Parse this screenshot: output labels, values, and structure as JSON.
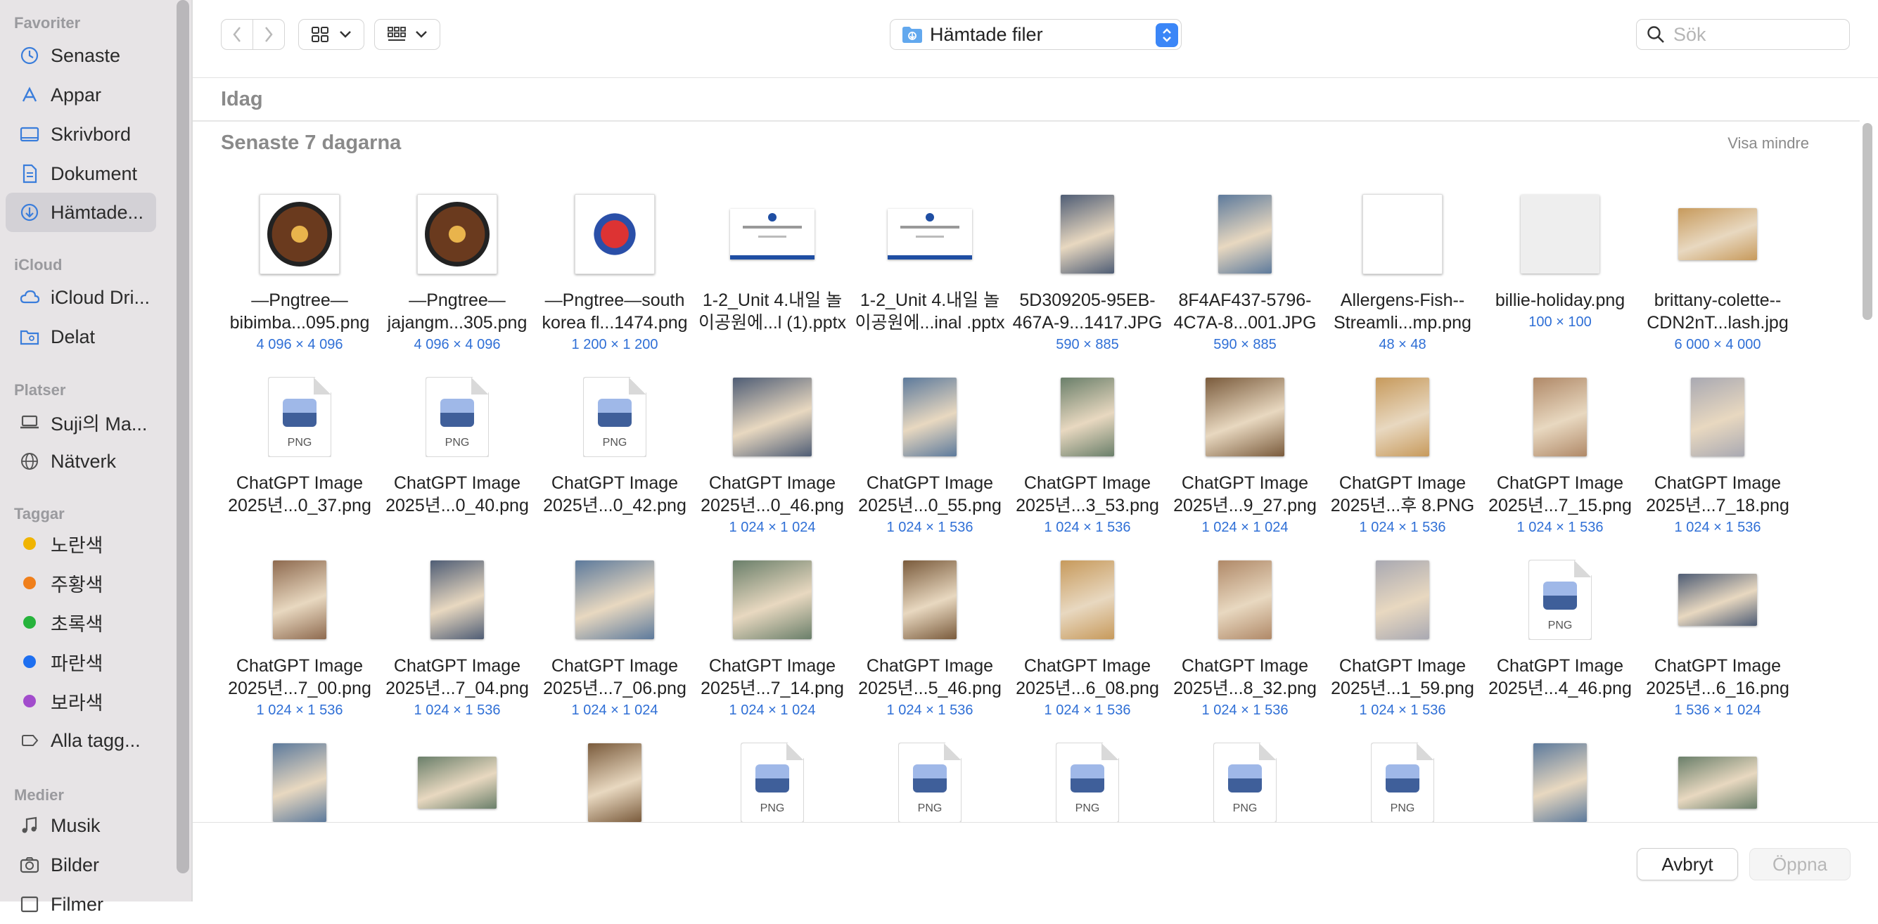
{
  "sidebar": {
    "sections": [
      {
        "title": "Favoriter",
        "items": [
          {
            "label": "Senaste",
            "icon": "clock-icon"
          },
          {
            "label": "Appar",
            "icon": "apps-icon"
          },
          {
            "label": "Skrivbord",
            "icon": "desktop-icon"
          },
          {
            "label": "Dokument",
            "icon": "document-icon"
          },
          {
            "label": "Hämtade...",
            "icon": "download-icon",
            "selected": true
          }
        ]
      },
      {
        "title": "iCloud",
        "items": [
          {
            "label": "iCloud Dri...",
            "icon": "cloud-icon"
          },
          {
            "label": "Delat",
            "icon": "shared-folder-icon"
          }
        ]
      },
      {
        "title": "Platser",
        "items": [
          {
            "label": "Suji의 Ma...",
            "icon": "laptop-icon"
          },
          {
            "label": "Nätverk",
            "icon": "network-icon"
          }
        ]
      },
      {
        "title": "Taggar",
        "items": [
          {
            "label": "노란색",
            "icon": "tag-dot-icon",
            "color": "#f0b400"
          },
          {
            "label": "주황색",
            "icon": "tag-dot-icon",
            "color": "#f07f1b"
          },
          {
            "label": "초록색",
            "icon": "tag-dot-icon",
            "color": "#27b33c"
          },
          {
            "label": "파란색",
            "icon": "tag-dot-icon",
            "color": "#1e6ff0"
          },
          {
            "label": "보라색",
            "icon": "tag-dot-icon",
            "color": "#a24ccc"
          },
          {
            "label": "Alla tagg...",
            "icon": "all-tags-icon"
          }
        ]
      },
      {
        "title": "Medier",
        "items": [
          {
            "label": "Musik",
            "icon": "music-icon"
          },
          {
            "label": "Bilder",
            "icon": "camera-icon"
          },
          {
            "label": "Filmer",
            "icon": "film-icon"
          }
        ]
      }
    ]
  },
  "toolbar": {
    "location": "Hämtade filer",
    "search_placeholder": "Sök",
    "accent_color": "#3b86f7"
  },
  "groups": {
    "today": "Idag",
    "last7": "Senaste 7 dagarna",
    "show_less": "Visa mindre"
  },
  "files": [
    {
      "name1": "—Pngtree—",
      "name2": "bibimba...095.png",
      "dims": "4 096 × 4 096",
      "thumb": "photo"
    },
    {
      "name1": "—Pngtree—",
      "name2": "jajangm...305.png",
      "dims": "4 096 × 4 096",
      "thumb": "photo"
    },
    {
      "name1": "—Pngtree—south",
      "name2": "korea fl...1474.png",
      "dims": "1 200 × 1 200",
      "thumb": "photo"
    },
    {
      "name1": "1-2_Unit 4.내일 놀",
      "name2": "이공원에...l (1).pptx",
      "dims": "",
      "thumb": "slide"
    },
    {
      "name1": "1-2_Unit 4.내일 놀",
      "name2": "이공원에...inal .pptx",
      "dims": "",
      "thumb": "slide"
    },
    {
      "name1": "5D309205-95EB-",
      "name2": "467A-9...1417.JPG",
      "dims": "590 × 885",
      "thumb": "photo"
    },
    {
      "name1": "8F4AF437-5796-",
      "name2": "4C7A-8...001.JPG",
      "dims": "590 × 885",
      "thumb": "photo"
    },
    {
      "name1": "Allergens-Fish--",
      "name2": "Streamli...mp.png",
      "dims": "48 × 48",
      "thumb": "photo"
    },
    {
      "name1": "billie-holiday.png",
      "name2": "",
      "dims": "100 × 100",
      "thumb": "photo"
    },
    {
      "name1": "brittany-colette--",
      "name2": "CDN2nT...lash.jpg",
      "dims": "6 000 × 4 000",
      "thumb": "photo"
    },
    {
      "name1": "ChatGPT Image",
      "name2": "2025년...0_37.png",
      "dims": "",
      "thumb": "doc",
      "badge": "PNG"
    },
    {
      "name1": "ChatGPT Image",
      "name2": "2025년...0_40.png",
      "dims": "",
      "thumb": "doc",
      "badge": "PNG"
    },
    {
      "name1": "ChatGPT Image",
      "name2": "2025년...0_42.png",
      "dims": "",
      "thumb": "doc",
      "badge": "PNG"
    },
    {
      "name1": "ChatGPT Image",
      "name2": "2025년...0_46.png",
      "dims": "1 024 × 1 024",
      "thumb": "photo"
    },
    {
      "name1": "ChatGPT Image",
      "name2": "2025년...0_55.png",
      "dims": "1 024 × 1 536",
      "thumb": "photo"
    },
    {
      "name1": "ChatGPT Image",
      "name2": "2025년...3_53.png",
      "dims": "1 024 × 1 536",
      "thumb": "photo"
    },
    {
      "name1": "ChatGPT Image",
      "name2": "2025년...9_27.png",
      "dims": "1 024 × 1 024",
      "thumb": "photo"
    },
    {
      "name1": "ChatGPT Image",
      "name2": "2025년...후 8.PNG",
      "dims": "1 024 × 1 536",
      "thumb": "photo"
    },
    {
      "name1": "ChatGPT Image",
      "name2": "2025년...7_15.png",
      "dims": "1 024 × 1 536",
      "thumb": "photo"
    },
    {
      "name1": "ChatGPT Image",
      "name2": "2025년...7_18.png",
      "dims": "1 024 × 1 536",
      "thumb": "photo"
    },
    {
      "name1": "ChatGPT Image",
      "name2": "2025년...7_00.png",
      "dims": "1 024 × 1 536",
      "thumb": "photo"
    },
    {
      "name1": "ChatGPT Image",
      "name2": "2025년...7_04.png",
      "dims": "1 024 × 1 536",
      "thumb": "photo"
    },
    {
      "name1": "ChatGPT Image",
      "name2": "2025년...7_06.png",
      "dims": "1 024 × 1 024",
      "thumb": "photo"
    },
    {
      "name1": "ChatGPT Image",
      "name2": "2025년...7_14.png",
      "dims": "1 024 × 1 024",
      "thumb": "photo"
    },
    {
      "name1": "ChatGPT Image",
      "name2": "2025년...5_46.png",
      "dims": "1 024 × 1 536",
      "thumb": "photo"
    },
    {
      "name1": "ChatGPT Image",
      "name2": "2025년...6_08.png",
      "dims": "1 024 × 1 536",
      "thumb": "photo"
    },
    {
      "name1": "ChatGPT Image",
      "name2": "2025년...8_32.png",
      "dims": "1 024 × 1 536",
      "thumb": "photo"
    },
    {
      "name1": "ChatGPT Image",
      "name2": "2025년...1_59.png",
      "dims": "1 024 × 1 536",
      "thumb": "photo"
    },
    {
      "name1": "ChatGPT Image",
      "name2": "2025년...4_46.png",
      "dims": "",
      "thumb": "doc",
      "badge": "PNG"
    },
    {
      "name1": "ChatGPT Image",
      "name2": "2025년...6_16.png",
      "dims": "1 536 × 1 024",
      "thumb": "photo"
    },
    {
      "name1": "",
      "name2": "",
      "dims": "",
      "thumb": "photo"
    },
    {
      "name1": "",
      "name2": "",
      "dims": "",
      "thumb": "photo"
    },
    {
      "name1": "",
      "name2": "",
      "dims": "",
      "thumb": "photo"
    },
    {
      "name1": "",
      "name2": "",
      "dims": "",
      "thumb": "doc",
      "badge": "PNG"
    },
    {
      "name1": "",
      "name2": "",
      "dims": "",
      "thumb": "doc",
      "badge": "PNG"
    },
    {
      "name1": "",
      "name2": "",
      "dims": "",
      "thumb": "doc",
      "badge": "PNG"
    },
    {
      "name1": "",
      "name2": "",
      "dims": "",
      "thumb": "doc",
      "badge": "PNG"
    },
    {
      "name1": "",
      "name2": "",
      "dims": "",
      "thumb": "doc",
      "badge": "PNG"
    },
    {
      "name1": "",
      "name2": "",
      "dims": "",
      "thumb": "photo"
    },
    {
      "name1": "",
      "name2": "",
      "dims": "",
      "thumb": "photo"
    }
  ],
  "buttons": {
    "cancel": "Avbryt",
    "open": "Öppna"
  }
}
